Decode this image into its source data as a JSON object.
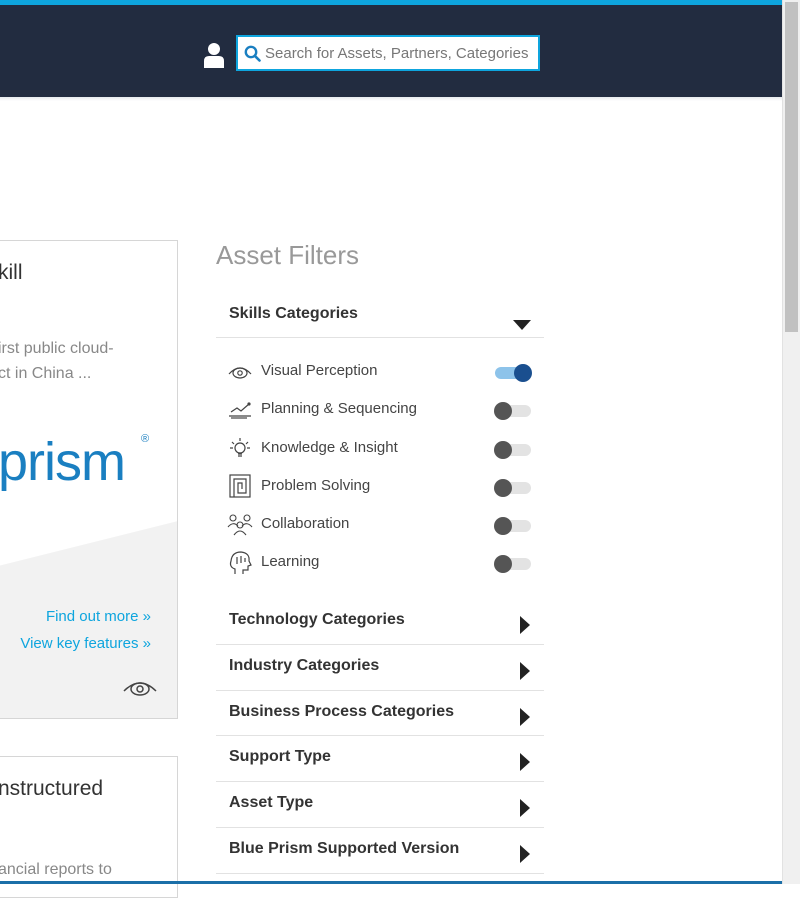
{
  "header": {
    "search_placeholder": "Search for Assets, Partners, Categories"
  },
  "cards": [
    {
      "title": "kill",
      "description": "irst public cloud-\nct in China ...",
      "logo_text": "prism",
      "logo_mark": "®",
      "links": [
        "Find out more »",
        "View key features »"
      ]
    },
    {
      "title": "nstructured",
      "description": "ancial reports to"
    }
  ],
  "filters": {
    "title": "Asset Filters",
    "skills_section": "Skills Categories",
    "skills": [
      {
        "label": "Visual Perception",
        "icon": "eye-icon",
        "enabled": true
      },
      {
        "label": "Planning & Sequencing",
        "icon": "planning-icon",
        "enabled": false
      },
      {
        "label": "Knowledge & Insight",
        "icon": "lightbulb-icon",
        "enabled": false
      },
      {
        "label": "Problem Solving",
        "icon": "maze-icon",
        "enabled": false
      },
      {
        "label": "Collaboration",
        "icon": "people-icon",
        "enabled": false
      },
      {
        "label": "Learning",
        "icon": "head-icon",
        "enabled": false
      }
    ],
    "sections": [
      "Technology Categories",
      "Industry Categories",
      "Business Process Categories",
      "Support Type",
      "Asset Type",
      "Blue Prism Supported Version"
    ]
  },
  "colors": {
    "header_bg": "#222c40",
    "accent": "#0ea5de",
    "brand_blue": "#1a7fc1",
    "toggle_on": "#1a4f8f"
  }
}
